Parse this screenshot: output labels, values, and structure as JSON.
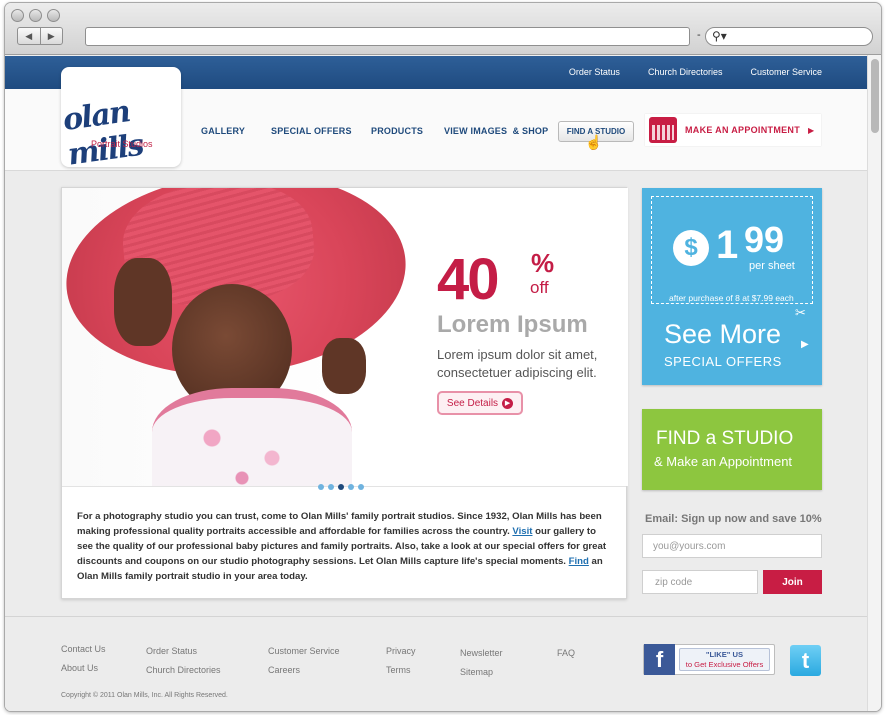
{
  "browser": {
    "back_icon": "back-arrow-icon",
    "forward_icon": "forward-arrow-icon",
    "url": "",
    "search_placeholder": ""
  },
  "topbar": {
    "links": [
      "Order Status",
      "Church Directories",
      "Customer Service"
    ]
  },
  "logo": {
    "text": "olan mills",
    "subtitle": "Portrait Studios"
  },
  "nav": {
    "items": [
      "GALLERY",
      "SPECIAL OFFERS",
      "PRODUCTS",
      "VIEW IMAGES  & SHOP",
      "FIND A STUDIO"
    ],
    "appointment": "MAKE AN APPOINTMENT"
  },
  "hero": {
    "discount": "40",
    "percent": "%",
    "off": "off",
    "heading": "Lorem Ipsum",
    "body": "Lorem ipsum dolor sit amet, consectetuer adipiscing elit.",
    "button": "See Details",
    "slides": 5,
    "active_slide": 3
  },
  "intro": {
    "part1": "For a photography studio you can trust, come to Olan Mills' family portrait studios. Since 1932, Olan Mills has been making professional quality portraits accessible and affordable for families across the country. ",
    "link1": "Visit",
    "part2": " our gallery to see the quality of our professional baby pictures and family portraits. Also, take a look at our special offers for great discounts and coupons on our studio photography sessions. Let Olan Mills capture life's special moments. ",
    "link2": "Find",
    "part3": " an Olan Mills family portrait studio in your area today."
  },
  "promo": {
    "currency": "$",
    "price_dollars": "1",
    "price_cents": "99",
    "unit": "per sheet",
    "condition": "after purchase of 8 at $7.99 each",
    "headline": "See More",
    "subheadline": "SPECIAL OFFERS"
  },
  "findbox": {
    "line1": "FIND a STUDIO",
    "line2": "& Make an Appointment"
  },
  "signup": {
    "label": "Email: Sign up now and save 10%",
    "email_placeholder": "you@yours.com",
    "zip_placeholder": "zip code",
    "button": "Join"
  },
  "footer": {
    "col1": [
      "Contact Us",
      "About Us"
    ],
    "col2": [
      "Order Status",
      "Church Directories"
    ],
    "col3": [
      "Customer Service",
      "Careers"
    ],
    "col4": [
      "Privacy",
      "Terms"
    ],
    "col5": [
      "Newsletter",
      "Sitemap"
    ],
    "col6": [
      "FAQ"
    ],
    "copyright": "Copyright © 2011 Olan Mills, Inc. All Rights Reserved.",
    "facebook_like": "\"LIKE\" US",
    "facebook_text": "to Get Exclusive Offers",
    "facebook_icon": "f",
    "twitter_icon": "t"
  }
}
